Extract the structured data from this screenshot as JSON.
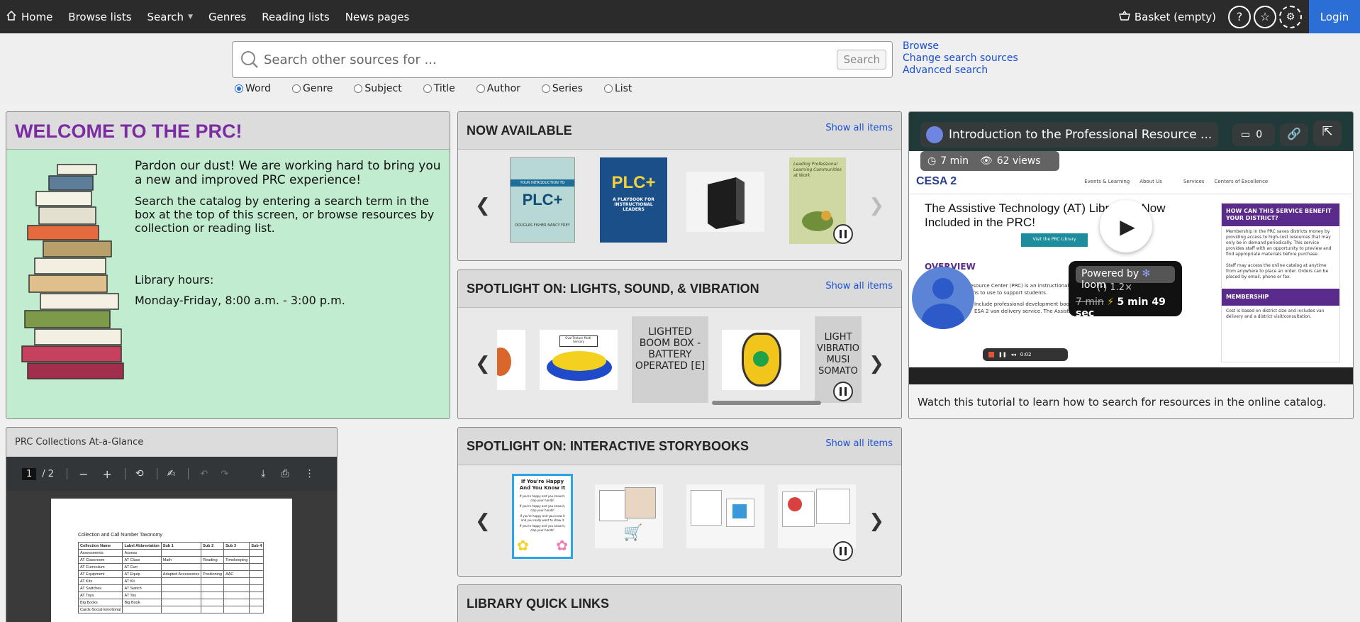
{
  "nav": {
    "items": [
      "Home",
      "Browse lists",
      "Search",
      "Genres",
      "Reading lists",
      "News pages"
    ],
    "basket": "Basket (empty)",
    "login": "Login"
  },
  "search": {
    "placeholder": "Search other sources for ...",
    "button": "Search",
    "links": [
      "Browse",
      "Change search sources",
      "Advanced search"
    ],
    "options": [
      "Word",
      "Genre",
      "Subject",
      "Title",
      "Author",
      "Series",
      "List"
    ],
    "selected": "Word"
  },
  "welcome": {
    "title": "WELCOME TO THE PRC!",
    "p1": "Pardon our dust! We are working hard to bring you a new and improved PRC experience!",
    "p2": "Search the catalog by entering a search term in the box at the top of this screen, or browse resources by collection or reading list.",
    "hours_label": "Library hours:",
    "hours": "Monday-Friday, 8:00 a.m. - 3:00 p.m."
  },
  "carousels": [
    {
      "title": "NOW AVAILABLE",
      "show_all": "Show all items",
      "covers": [
        {
          "title": "PLC+",
          "subtitle": "YOUR INTRODUCTION TO",
          "authors": "DOUGLAS FISHER  NANCY FREY",
          "bg": "#b7d8d4"
        },
        {
          "title": "PLC+",
          "subtitle": "A PLAYBOOK FOR INSTRUCTIONAL LEADERS",
          "bg": "#1b4f8a"
        },
        {
          "title": "",
          "bg": "#f4f4f4"
        },
        {
          "title": "Leading Professional Learning Communities at Work",
          "bg": "#cfd8a2"
        }
      ]
    },
    {
      "title": "SPOTLIGHT ON: LIGHTS, SOUND, & VIBRATION",
      "show_all": "Show all items",
      "text_items": [
        "LIGHTED BOOM BOX - BATTERY OPERATED [E]",
        "LIGHT VIBRATIO MUSI SOMATO"
      ]
    },
    {
      "title": "SPOTLIGHT ON: INTERACTIVE STORYBOOKS",
      "show_all": "Show all items",
      "book1": {
        "title": "If You're Happy And You Know It",
        "lines": [
          "If you're happy and you know it, clap your hands!",
          "If you're happy and you know it, clap your hands!",
          "If you're happy and you know it and you really want to show it",
          "If you're happy and you know it, clap your hands!"
        ]
      }
    },
    {
      "title": "LIBRARY QUICK LINKS"
    }
  ],
  "video": {
    "title": "Introduction to the Professional Resource ...",
    "comments": "0",
    "duration": "7 min",
    "views": "62 views",
    "powered_by": "Powered by",
    "loom": "loom",
    "old_time": "7 min",
    "new_time": "5 min 49 sec",
    "speed": "(·) 1.2×",
    "timecode": "0:02",
    "caption": "Watch this tutorial to learn how to search for resources in the online catalog.",
    "site": {
      "logo": "CESA 2",
      "nav": [
        "Events & Learning",
        "About Us",
        "Services",
        "Centers of Excellence"
      ],
      "headline": "The Assistive Technology (AT) Library is Now Included in the PRC!",
      "visit": "Visit the PRC Library",
      "overview": "OVERVIEW",
      "body1": "The Professional Resource Center (PRC) is an instructional materials library for both special and regular education classrooms to use to support students.",
      "body2": "Include professional development books, kits, and so much more. This service",
      "body3": "ESA 2 van delivery service. The Assistive Technology equipment, and accessories.",
      "side_h1": "HOW CAN THIS SERVICE BENEFIT YOUR DISTRICT?",
      "side_p1": "Membership in the PRC saves districts money by providing access to high-cost resources that may only be in demand periodically. This service provides staff with an opportunity to preview and find appropriate materials before purchase.",
      "side_p2": "Staff may access the online catalog at anytime from anywhere to place an order. Orders can be placed by email, phone or fax.",
      "side_h2": "MEMBERSHIP",
      "side_p3": "Cost is based on district size and includes van delivery and a district visit/consultation."
    }
  },
  "pdf": {
    "title": "PRC Collections At-a-Glance",
    "page": "1",
    "pages": "/  2",
    "doc_title": "Collection and Call Number Taxonomy",
    "headers": [
      "Collection Name",
      "Label Abbreviation",
      "Sub 1",
      "Sub 2",
      "Sub 3",
      "Sub 4"
    ],
    "rows": [
      [
        "Assessments",
        "Assess",
        "",
        "",
        "",
        ""
      ],
      [
        "AT Classroom",
        "AT Class",
        "Math",
        "Reading",
        "Timekeeping",
        ""
      ],
      [
        "AT Curriculum",
        "AT Curr",
        "",
        "",
        "",
        ""
      ],
      [
        "AT Equipment",
        "AT Equip",
        "Adapted Accessories",
        "Positioning",
        "AAC",
        ""
      ],
      [
        "AT Kits",
        "AT Kit",
        "",
        "",
        "",
        ""
      ],
      [
        "AT Switches",
        "AT Switch",
        "",
        "",
        "",
        ""
      ],
      [
        "AT Toys",
        "AT Toy",
        "",
        "",
        "",
        ""
      ],
      [
        "Big Books",
        "Big Book",
        "",
        "",
        "",
        ""
      ],
      [
        "Cards-Social Emotional",
        "",
        "",
        "",
        "",
        ""
      ]
    ]
  },
  "colors": {
    "nav_bg": "#2b2b2b",
    "login": "#2b6fd6",
    "welcome_bg": "#c2ecd0",
    "welcome_title": "#7b2ca3",
    "link": "#1a4fd6"
  }
}
